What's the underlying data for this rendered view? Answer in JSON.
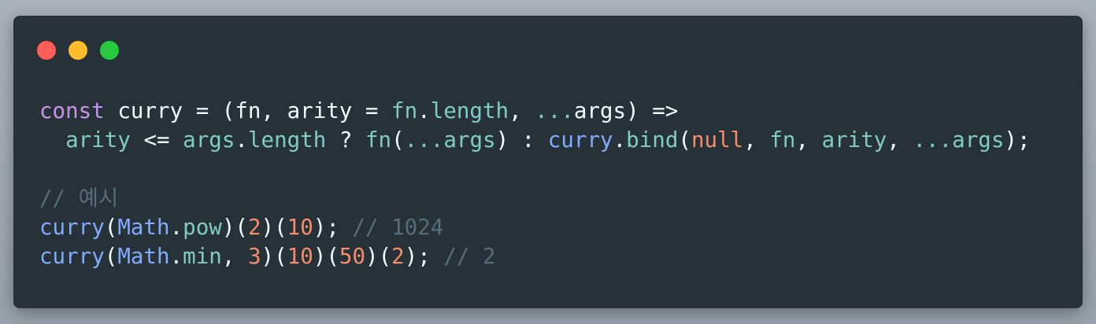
{
  "window": {
    "traffic_lights": [
      "close",
      "minimize",
      "maximize"
    ]
  },
  "code": {
    "line1": {
      "t1": "const",
      "t2": " curry = (fn, arity = ",
      "t3": "fn",
      "t4": ".",
      "t5": "length",
      "t6": ", ",
      "t7": "...",
      "t8": "args) =>"
    },
    "line2": {
      "t1": "  ",
      "t2": "arity",
      "t3": " <= ",
      "t4": "args",
      "t5": ".",
      "t6": "length",
      "t7": " ? ",
      "t8": "fn",
      "t9": "(",
      "t10": "...",
      "t11": "args",
      "t12": ") : ",
      "t13": "curry",
      "t14": ".",
      "t15": "bind",
      "t16": "(",
      "t17": "null",
      "t18": ", ",
      "t19": "fn",
      "t20": ", ",
      "t21": "arity",
      "t22": ", ",
      "t23": "...",
      "t24": "args",
      "t25": ");"
    },
    "comment_example": "// 예시",
    "line5": {
      "t1": "curry",
      "t2": "(",
      "t3": "Math",
      "t4": ".",
      "t5": "pow",
      "t6": ")(",
      "t7": "2",
      "t8": ")(",
      "t9": "10",
      "t10": "); ",
      "t11": "// 1024"
    },
    "line6": {
      "t1": "curry",
      "t2": "(",
      "t3": "Math",
      "t4": ".",
      "t5": "min",
      "t6": ", ",
      "t7": "3",
      "t8": ")(",
      "t9": "10",
      "t10": ")(",
      "t11": "50",
      "t12": ")(",
      "t13": "2",
      "t14": "); ",
      "t15": "// 2"
    }
  },
  "colors": {
    "background": "#263238",
    "keyword": "#c792ea",
    "function": "#82aaff",
    "property": "#80cbc4",
    "number": "#f78c6c",
    "comment": "#546e7a",
    "text": "#eeffff"
  }
}
